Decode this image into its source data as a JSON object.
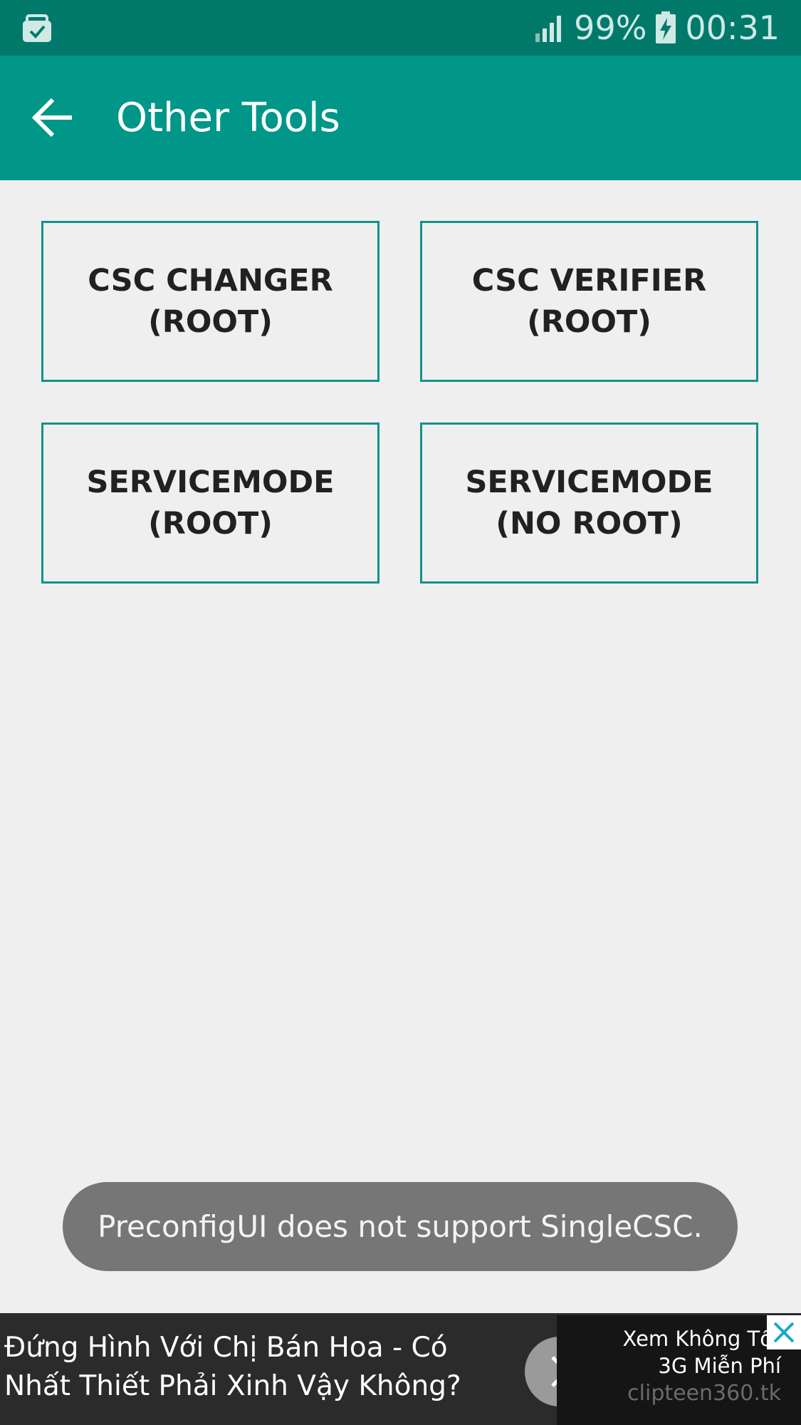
{
  "status_bar": {
    "left_icon": "briefcase-check-icon",
    "signal_icon": "signal-icon",
    "battery_percent": "99%",
    "battery_icon": "battery-charging-icon",
    "time": "00:31"
  },
  "app_bar": {
    "back_icon": "arrow-back-icon",
    "title": "Other Tools"
  },
  "tools": [
    {
      "label": "CSC CHANGER\n(ROOT)"
    },
    {
      "label": "CSC VERIFIER\n(ROOT)"
    },
    {
      "label": "SERVICEMODE\n(ROOT)"
    },
    {
      "label": "SERVICEMODE\n(NO ROOT)"
    }
  ],
  "toast": {
    "message": "PreconfigUI does not support SingleCSC."
  },
  "ad": {
    "headline_line1": "Đứng Hình Với Chị Bán Hoa - Có",
    "headline_line2": "Nhất Thiết Phải Xinh Vậy Không?",
    "side_line1": "Xem Không Tố",
    "side_line2": "3G Miễn Phí",
    "domain": "clipteen360.tk",
    "arrow_icon": "chevron-right-icon",
    "close_icon": "close-icon"
  },
  "colors": {
    "status_bar": "#00796b",
    "app_bar": "#009688",
    "button_border": "#13928a",
    "background": "#efefef",
    "toast": "#767676",
    "ad_background": "#2b2b2b"
  }
}
